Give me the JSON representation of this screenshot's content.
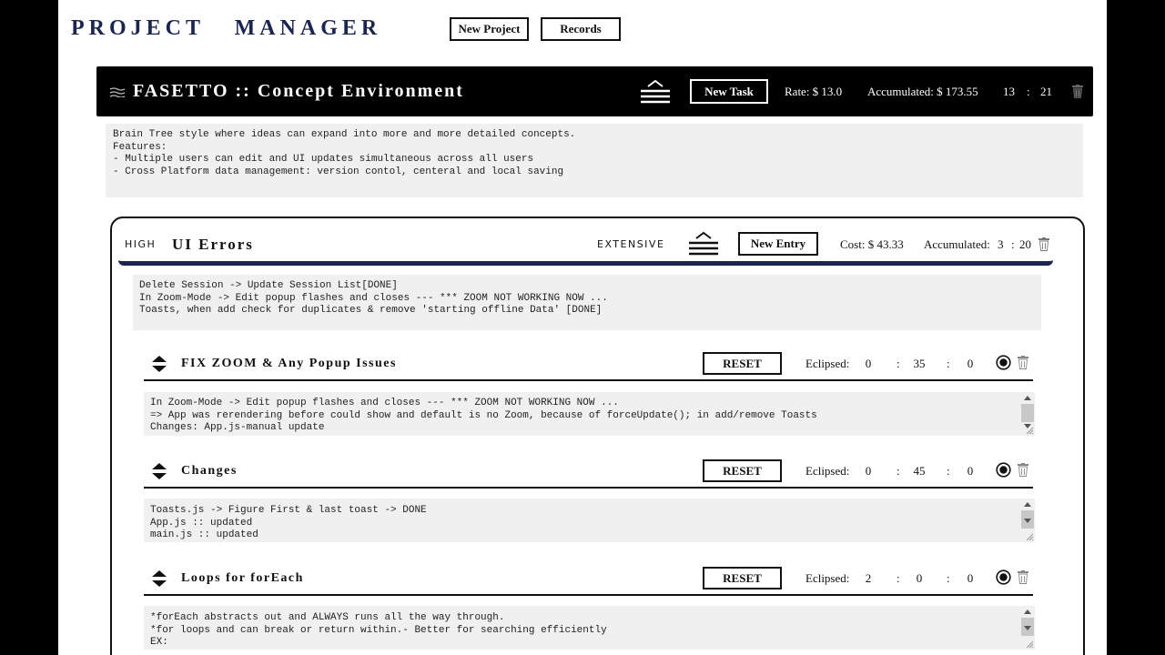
{
  "app": {
    "title": "PROJECT   MANAGER",
    "new_project_label": "New Project",
    "records_label": "Records"
  },
  "project": {
    "title": "FASETTO :: Concept Environment",
    "new_task_label": "New Task",
    "rate": "Rate: $ 13.0",
    "accumulated": "Accumulated: $ 173.55",
    "hours": "13",
    "sep": ":",
    "minutes": "21",
    "notes": "Brain Tree style where ideas can expand into more and more detailed concepts.\nFeatures:\n- Multiple users can edit and UI updates simultaneous across all users\n- Cross Platform data management: version contol, centeral and local saving",
    "icons": {
      "menu": "menu-lines-icon",
      "trash": "trash-icon",
      "wave": "wave-icon"
    }
  },
  "section": {
    "priority": "HIGH",
    "title": "UI Errors",
    "effort": "EXTENSIVE",
    "new_entry_label": "New Entry",
    "cost": "Cost: $ 43.33",
    "accumulated_label": "Accumulated:",
    "acc_hours": "3",
    "acc_sep": ":",
    "acc_minutes": "20",
    "notes": "Delete Session -> Update Session List[DONE]\nIn Zoom-Mode -> Edit popup flashes and closes --- *** ZOOM NOT WORKING NOW ...\nToasts, when add check for duplicates & remove 'starting offline Data' [DONE]"
  },
  "entries": [
    {
      "title": "FIX ZOOM & Any Popup Issues",
      "reset_label": "RESET",
      "elapsed_label": "Eclipsed:",
      "hours": "0",
      "minutes": "35",
      "seconds": "0",
      "sep": ":",
      "notes": "In Zoom-Mode -> Edit popup flashes and closes --- *** ZOOM NOT WORKING NOW ...\n=> App was rerendering before could show and default is no Zoom, because of forceUpdate(); in add/remove Toasts\nChanges: App.js-manual update"
    },
    {
      "title": "Changes",
      "reset_label": "RESET",
      "elapsed_label": "Eclipsed:",
      "hours": "0",
      "minutes": "45",
      "seconds": "0",
      "sep": ":",
      "notes": "Toasts.js -> Figure First & last toast -> DONE\nApp.js :: updated\nmain.js :: updated"
    },
    {
      "title": "Loops for forEach",
      "reset_label": "RESET",
      "elapsed_label": "Eclipsed:",
      "hours": "2",
      "minutes": "0",
      "seconds": "0",
      "sep": ":",
      "notes": "*forEach abstracts out and ALWAYS runs all the way through.\n*for loops and can break or return within.- Better for searching efficiently\nEX:"
    }
  ],
  "colors": {
    "navy": "#1b2550",
    "bar_bg": "#000000",
    "notes_bg": "#f0f0f0"
  }
}
